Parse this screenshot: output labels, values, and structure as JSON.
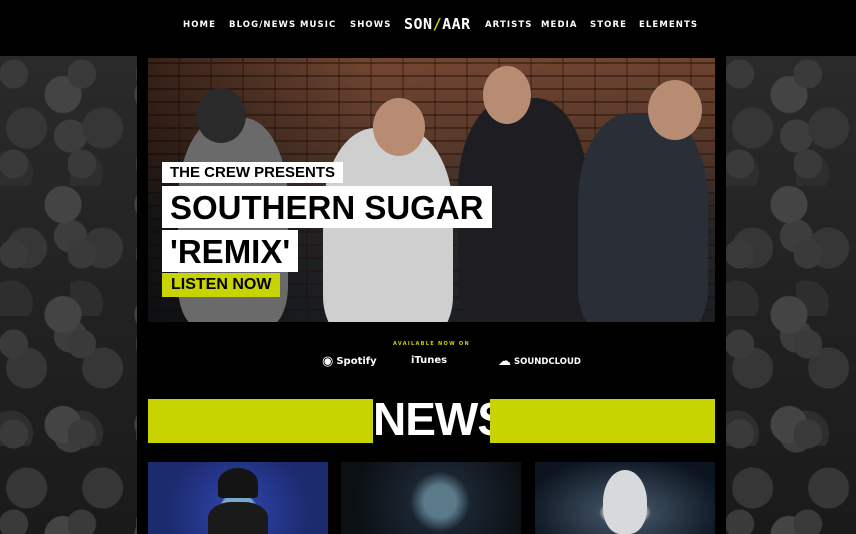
{
  "nav": {
    "home": "HOME",
    "blog": "BLOG/NEWS",
    "music": "MUSIC",
    "shows": "SHOWS",
    "logo_left": "SON",
    "logo_slash": "/",
    "logo_right": "AAR",
    "artists": "ARTISTS",
    "media": "MEDIA",
    "store": "STORE",
    "elements": "ELEMENTS"
  },
  "hero": {
    "presents": "THE CREW PRESENTS",
    "title_line1": "SOUTHERN SUGAR",
    "title_line2": "'REMIX'",
    "cta": "LISTEN NOW"
  },
  "available": {
    "heading": "AVAILABLE NOW ON",
    "spotify": "Spotify",
    "itunes": "iTunes",
    "soundcloud": "SOUNDCLOUD"
  },
  "news": {
    "title": "NEWS"
  },
  "colors": {
    "accent": "#c8d400",
    "background": "#000000",
    "text": "#ffffff"
  }
}
